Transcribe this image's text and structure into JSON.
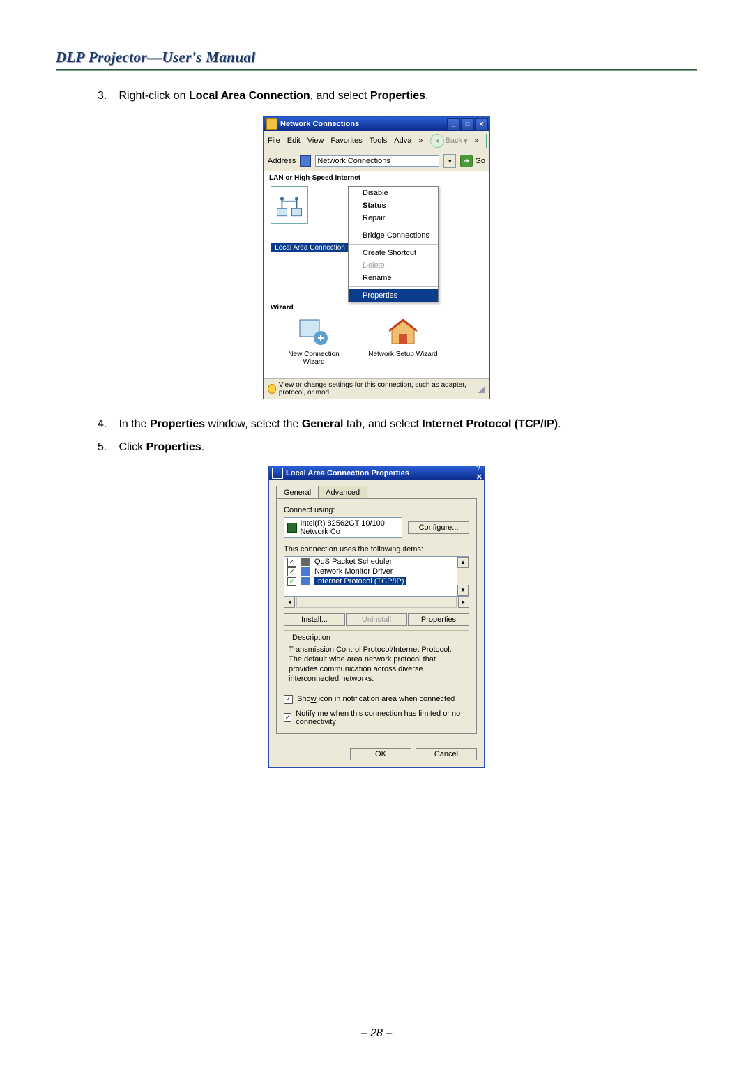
{
  "header": {
    "title": "DLP Projector—User's Manual"
  },
  "steps": {
    "s3": {
      "num": "3.",
      "pre": "Right-click on ",
      "b1": "Local Area Connection",
      "mid": ", and select ",
      "b2": "Properties",
      "post": "."
    },
    "s4": {
      "num": "4.",
      "pre": "In the ",
      "b1": "Properties",
      "mid1": " window, select the ",
      "b2": "General",
      "mid2": " tab, and select ",
      "b3": "Internet Protocol (TCP/IP)",
      "post": "."
    },
    "s5": {
      "num": "5.",
      "pre": "Click ",
      "b1": "Properties",
      "post": "."
    }
  },
  "win1": {
    "title": "Network Connections",
    "menus": [
      "File",
      "Edit",
      "View",
      "Favorites",
      "Tools",
      "Adva"
    ],
    "moreGlyph": "»",
    "back": "Back",
    "addressLabel": "Address",
    "addressValue": "Network Connections",
    "go": "Go",
    "group1": "LAN or High-Speed Internet",
    "connLabel": "Local Area Connection",
    "context": {
      "disable": "Disable",
      "status": "Status",
      "repair": "Repair",
      "bridge": "Bridge Connections",
      "shortcut": "Create Shortcut",
      "delete": "Delete",
      "rename": "Rename",
      "properties": "Properties"
    },
    "wizardLabel": "Wizard",
    "wiz1": "New Connection Wizard",
    "wiz2": "Network Setup Wizard",
    "status": "View or change settings for this connection, such as adapter, protocol, or mod"
  },
  "dlg": {
    "title": "Local Area Connection Properties",
    "help": "?",
    "tabGeneral": "General",
    "tabAdvanced": "Advanced",
    "connectUsing": "Connect using:",
    "adapter": "Intel(R) 82562GT 10/100 Network Co",
    "configure": "Configure...",
    "usesItems": "This connection uses the following items:",
    "item1": "QoS Packet Scheduler",
    "item2": "Network Monitor Driver",
    "item3": "Internet Protocol (TCP/IP)",
    "install": "Install...",
    "uninstall": "Uninstall",
    "properties": "Properties",
    "descLabel": "Description",
    "desc": "Transmission Control Protocol/Internet Protocol. The default wide area network protocol that provides communication across diverse interconnected networks.",
    "chk1a": "Sho",
    "chk1u": "w",
    "chk1b": " icon in notification area when connected",
    "chk2a": "Notify ",
    "chk2u": "m",
    "chk2b": "e when this connection has limited or no connectivity",
    "ok": "OK",
    "cancel": "Cancel"
  },
  "pageNumber": "– 28 –"
}
